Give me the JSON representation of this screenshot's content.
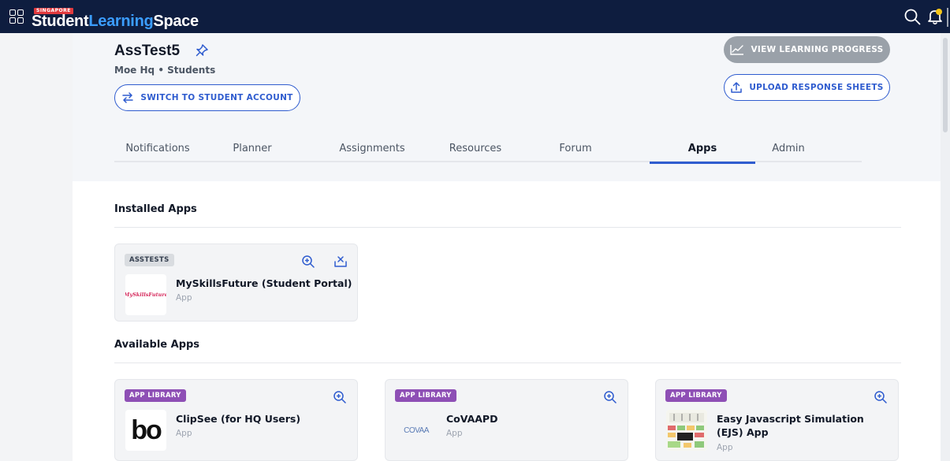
{
  "topbar": {
    "brand_country": "SINGAPORE",
    "brand_word1": "Student",
    "brand_word2": "Learning",
    "brand_word3": "Space",
    "icons": [
      "apps-grid-icon",
      "search-icon",
      "bell-icon"
    ],
    "bell_badge_color": "#f5c518",
    "bg_color": "#0e1d3f"
  },
  "course": {
    "title": "AssTest5",
    "subtitle": "Moe Hq • Students",
    "switch_button": "SWITCH TO STUDENT ACCOUNT",
    "progress_button": "VIEW LEARNING PROGRESS",
    "upload_button": "UPLOAD RESPONSE SHEETS"
  },
  "tabs": [
    {
      "label": "Notifications",
      "active": false
    },
    {
      "label": "Planner",
      "active": false
    },
    {
      "label": "Assignments",
      "active": false
    },
    {
      "label": "Resources",
      "active": false
    },
    {
      "label": "Forum",
      "active": false
    },
    {
      "label": "Apps",
      "active": true
    },
    {
      "label": "Admin",
      "active": false
    }
  ],
  "installed": {
    "title": "Installed Apps",
    "apps": [
      {
        "tag": "ASSTESTS",
        "name": "MySkillsFuture (Student Portal)",
        "type": "App",
        "logo_text": "MySkillsFuture"
      }
    ]
  },
  "available": {
    "title": "Available Apps",
    "apps": [
      {
        "tag": "APP LIBRARY",
        "name": "ClipSee (for HQ Users)",
        "type": "App",
        "logo_text": "bo"
      },
      {
        "tag": "APP LIBRARY",
        "name": "CoVAAPD",
        "type": "App",
        "logo_text": "COVAA"
      },
      {
        "tag": "APP LIBRARY",
        "name": "Easy Javascript Simulation (EJS) App",
        "type": "App"
      }
    ]
  },
  "colors": {
    "accent": "#2f5ccf",
    "tag_purple": "#8e4fb5",
    "tag_grey": "#d9dce0"
  }
}
